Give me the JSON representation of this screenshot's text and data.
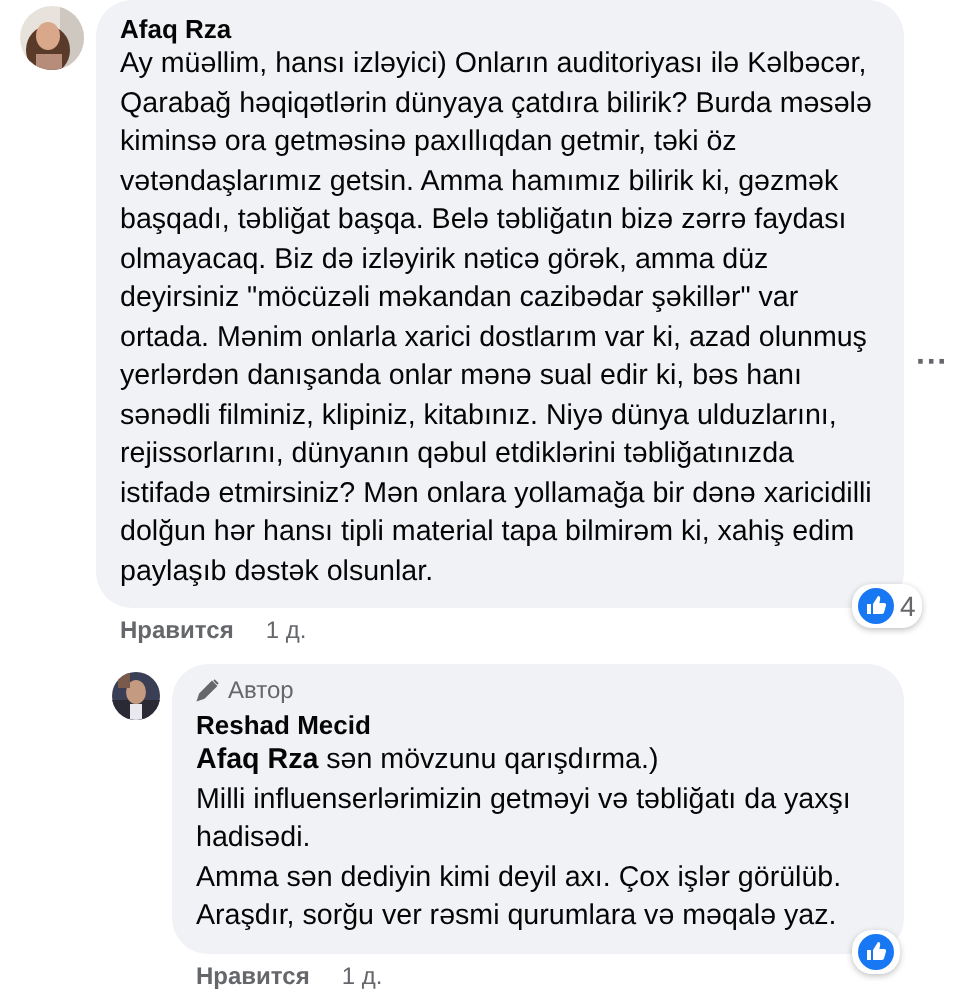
{
  "comments": [
    {
      "author": "Afaq Rza",
      "paragraphs": [
        "Ay müəllim, hansı izləyici) Onların auditoriyası ilə Kəlbəcər, Qarabağ həqiqətlərin dünyaya çatdıra bilirik? Burda məsələ kiminsə ora getməsinə paxıllıqdan getmir, təki öz vətəndaşlarımız getsin. Amma hamımız bilirik ki, gəzmək başqadı, təbliğat başqa. Belə təbliğatın bizə zərrə faydası olmayacaq. Biz də izləyirik nəticə görək, amma düz deyirsiniz \"möcüzəli məkandan cazibədar şəkillər\" var ortada. Mənim onlarla xarici dostlarım var ki, azad olunmuş yerlərdən danışanda onlar mənə sual edir ki, bəs hanı sənədli filminiz, klipiniz, kitabınız. Niyə dünya ulduzlarını, rejissorlarını, dünyanın qəbul etdiklərini təbliğatınızda istifadə etmirsiniz? Mən onlara yollamağa bir dənə xaricidilli dolğun hər hansı tipli material tapa bilmirəm ki, xahiş edim paylaşıb dəstək olsunlar."
      ],
      "reaction_count": "4",
      "like_action": "Нравится",
      "time": "1 д.",
      "more": "···"
    },
    {
      "author": "Reshad Mecid",
      "badge": "Автор",
      "paragraphs": [
        "**Afaq Rza** sən mövzunu qarışdırma.)",
        "Milli influenserlərimizin getməyi və təbliğatı da yaxşı hadisədi.",
        "Amma sən dediyin kimi deyil axı. Çox işlər görülüb.",
        "Araşdır, sorğu ver rəsmi qurumlara və məqalə yaz."
      ],
      "like_action": "Нравится",
      "time": "1 д."
    }
  ]
}
